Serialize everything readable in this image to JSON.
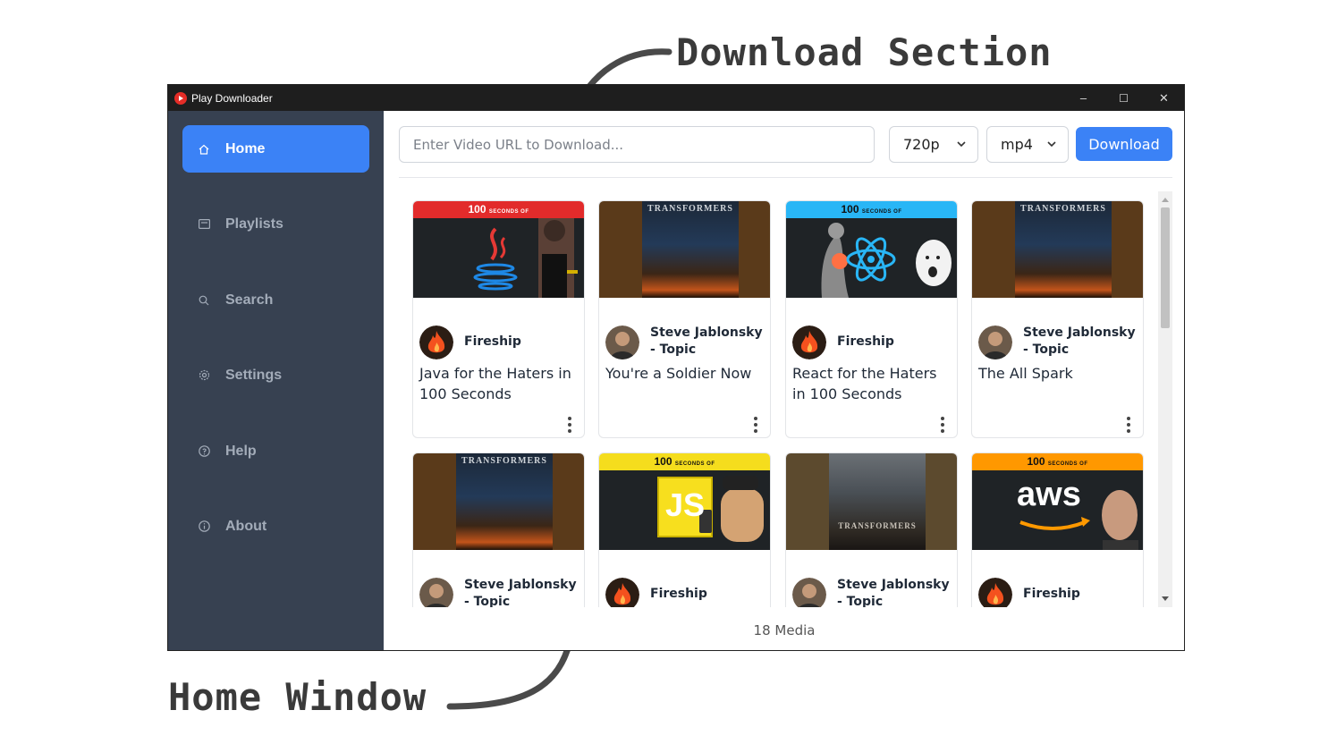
{
  "annotations": {
    "download_section": "Download Section",
    "home_window": "Home Window"
  },
  "window": {
    "title": "Play Downloader",
    "controls": {
      "minimize": "–",
      "maximize": "☐",
      "close": "✕"
    }
  },
  "sidebar": {
    "items": [
      {
        "label": "Home",
        "icon": "home-icon",
        "active": true
      },
      {
        "label": "Playlists",
        "icon": "playlist-icon"
      },
      {
        "label": "Search",
        "icon": "search-icon"
      },
      {
        "label": "Settings",
        "icon": "gear-icon"
      },
      {
        "label": "Help",
        "icon": "help-icon"
      },
      {
        "label": "About",
        "icon": "info-icon"
      }
    ]
  },
  "download": {
    "url_placeholder": "Enter Video URL to Download...",
    "url_value": "",
    "resolution": "720p",
    "format": "mp4",
    "button_label": "Download"
  },
  "media": {
    "cards": [
      {
        "channel": "Fireship",
        "title": "Java for the Haters in 100 Seconds",
        "thumb": "fireship-java"
      },
      {
        "channel": "Steve Jablonsky - Topic",
        "title": "You're a Soldier Now",
        "thumb": "transformers"
      },
      {
        "channel": "Fireship",
        "title": "React for the Haters in 100 Seconds",
        "thumb": "fireship-react"
      },
      {
        "channel": "Steve Jablonsky - Topic",
        "title": "The All Spark",
        "thumb": "transformers"
      },
      {
        "channel": "Steve Jablonsky - Topic",
        "title": "",
        "thumb": "transformers"
      },
      {
        "channel": "Fireship",
        "title": "",
        "thumb": "fireship-js"
      },
      {
        "channel": "Steve Jablonsky - Topic",
        "title": "",
        "thumb": "transformers-aoe"
      },
      {
        "channel": "Fireship",
        "title": "",
        "thumb": "fireship-aws"
      }
    ],
    "thumb_text": {
      "banner": "100",
      "banner_small": "SECONDS OF",
      "transformers_logo": "TRANSFORMERS",
      "aws": "aws",
      "js": "JS"
    },
    "count_label": "18 Media"
  },
  "colors": {
    "sidebar_bg": "#374151",
    "accent": "#3b82f6",
    "titlebar_bg": "#1e1e1e"
  }
}
